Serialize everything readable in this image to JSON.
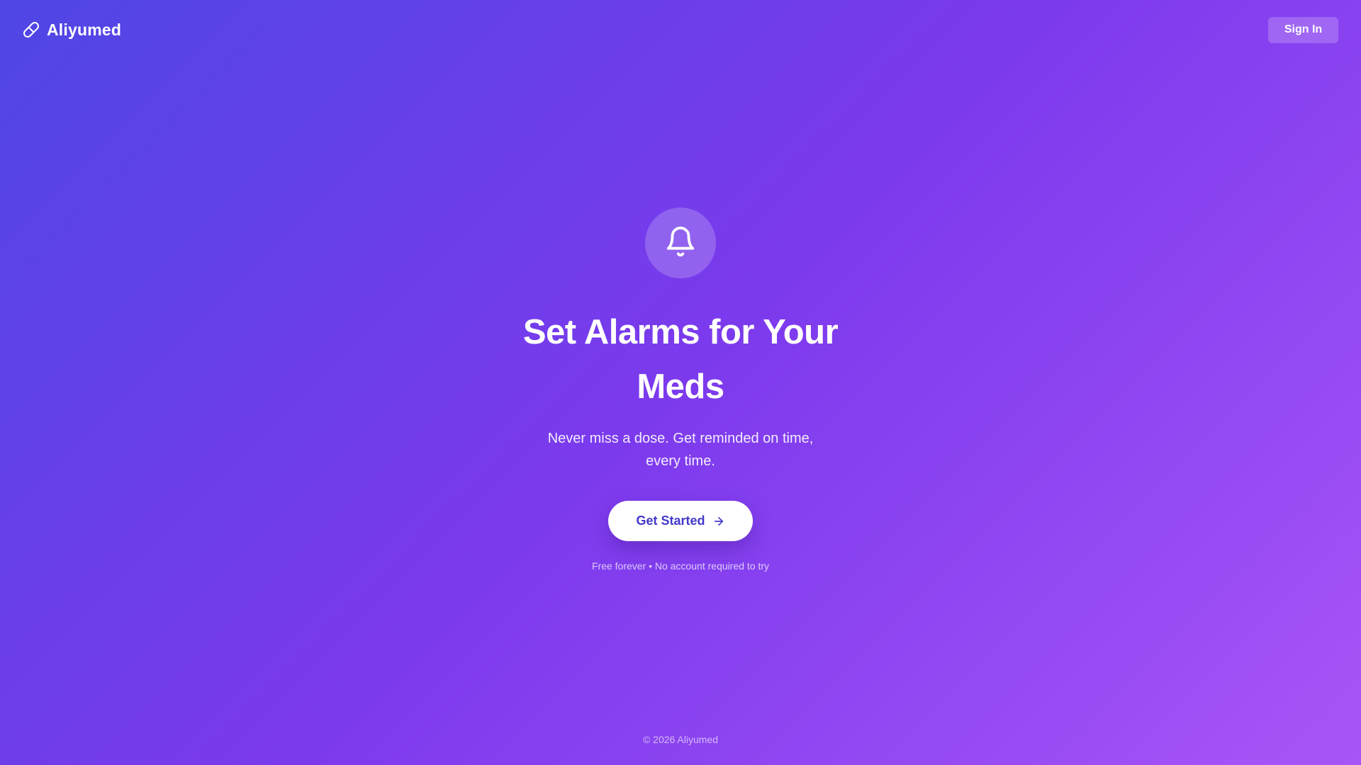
{
  "header": {
    "brand_icon": "pill-icon",
    "brand_name": "Aliyumed",
    "signin_label": "Sign In"
  },
  "hero": {
    "icon": "bell-icon",
    "headline": "Set Alarms for Your Meds",
    "subtext": "Never miss a dose. Get reminded on time, every time.",
    "cta_label": "Get Started",
    "cta_icon": "arrow-right-icon",
    "note": "Free forever • No account required to try"
  },
  "footer": {
    "copyright": "© 2026 Aliyumed"
  },
  "colors": {
    "gradient_start": "#4f46e5",
    "gradient_mid": "#7c3aed",
    "gradient_end": "#a855f7",
    "cta_text": "#4338ca",
    "text": "#ffffff"
  }
}
